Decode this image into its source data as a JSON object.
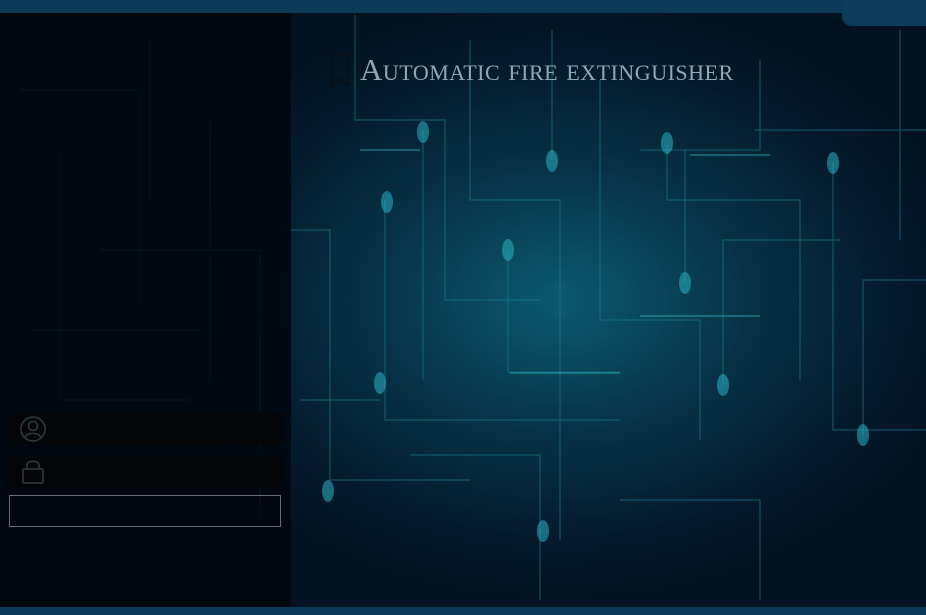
{
  "app": {
    "title": "Automatic fire extinguisher"
  },
  "login": {
    "username_placeholder": "",
    "password_placeholder": "",
    "submit_label": ""
  },
  "icons": {
    "title_icon": "bookmark-icon",
    "username_icon": "user-icon",
    "password_icon": "lock-icon"
  },
  "colors": {
    "background": "#04121f",
    "circuit": "#1ea3b0",
    "title_text": "#8ea8b8",
    "panel": "#000408"
  }
}
